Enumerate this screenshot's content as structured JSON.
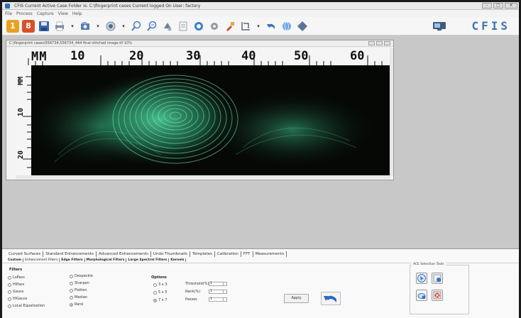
{
  "window": {
    "title": "CFIS   Current Active Case Folder is: C:\\fingerprint cases      Current logged On User: factory",
    "controls": [
      "–",
      "▢",
      "✕"
    ]
  },
  "menu": [
    "File",
    "Process",
    "Capture",
    "View",
    "Help"
  ],
  "toolbar": {
    "brand": "CFIS",
    "icons": [
      "button-1-icon",
      "button-8-icon",
      "save-icon",
      "print-icon",
      "capture-icon",
      "camera-icon",
      "zoom-in-icon",
      "zoom-out-icon",
      "rotate-icon",
      "document-icon",
      "refresh-icon",
      "settings-icon",
      "tools-icon",
      "crop-icon",
      "undo-icon",
      "globe-icon",
      "shape-icon"
    ],
    "button1_label": "1",
    "button8_label": "8"
  },
  "image_window": {
    "title": "C:\\fingerprint cases\\556734,556734_444  final stitched image.tif 10%",
    "ruler_top_unit": "MM",
    "ruler_top_numbers": [
      "10",
      "20",
      "30",
      "40",
      "50",
      "60"
    ],
    "ruler_left_unit": "MM",
    "ruler_left_numbers": [
      "10",
      "20"
    ]
  },
  "tabs": [
    "Curved Surfaces",
    "Standard Enhancements",
    "Advanced Enhancements",
    "Undo Thumbnails",
    "Templates",
    "Calibration",
    "FFT",
    "Measurements"
  ],
  "active_tab": "Advanced Enhancements",
  "subtabs": [
    "Custom",
    "Enhancement Filters",
    "Edge Filters",
    "Morphological Filters",
    "Large Spectral Filters",
    "Kernels"
  ],
  "active_subtab": "Enhancement Filters",
  "filters": {
    "label": "Filters",
    "col1": [
      "LoPass",
      "HiPass",
      "Gauss",
      "HiGauss",
      "Local Equalization"
    ],
    "col2": [
      "Despeckle",
      "Sharpen",
      "Flatten",
      "Median",
      "Rank"
    ],
    "selected": "Rank"
  },
  "options": {
    "label": "Options",
    "kernels": [
      "3 x 3",
      "5 x 5",
      "7 x 7"
    ],
    "selected_kernel": "7 x 7",
    "fields": [
      {
        "label": "Threshold(%)",
        "value": "1"
      },
      {
        "label": "Rank(%)",
        "value": "1"
      },
      {
        "label": "Passes",
        "value": "1"
      }
    ]
  },
  "apply_label": "Apply",
  "ace": {
    "title": "ACE Selection Tools",
    "buttons": [
      "ace-select-icon",
      "ace-add-icon",
      "ace-cloud-icon",
      "ace-delete-icon"
    ]
  },
  "colors": {
    "accent": "#3f72b4",
    "fingerprint": "#5fd59a",
    "background": "#c6c6c6"
  }
}
